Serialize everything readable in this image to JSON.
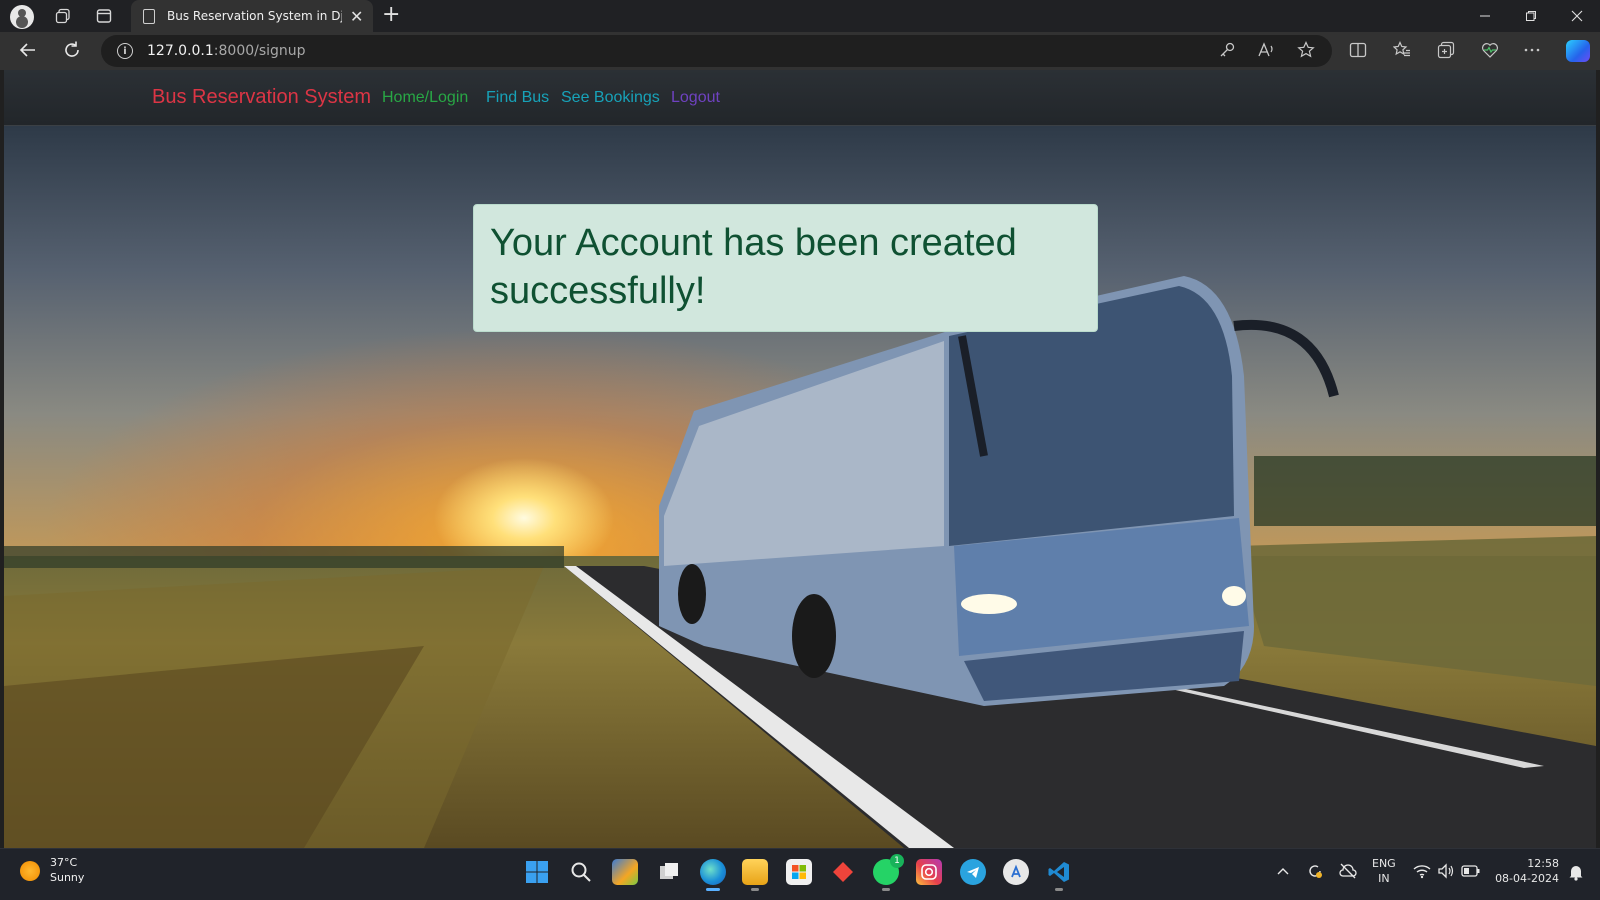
{
  "browser": {
    "tab_title": "Bus Reservation System in Djang",
    "url_host": "127.0.0.1",
    "url_path": ":8000/signup",
    "new_tab_symbol": "+",
    "close_tab_symbol": "✕"
  },
  "navbar": {
    "brand": "Bus Reservation System",
    "links": [
      {
        "label": "Home/Login",
        "color": "#28a745"
      },
      {
        "label": "Find Bus",
        "color": "#17a2b8"
      },
      {
        "label": "See Bookings",
        "color": "#17a2b8"
      },
      {
        "label": "Logout",
        "color": "#6f42c1"
      }
    ],
    "brand_color": "#dc3545"
  },
  "alert": {
    "message": "Your Account has been created successfully!",
    "bg_color": "#d1e7dd",
    "text_color": "#0f5132"
  },
  "taskbar": {
    "weather_temp": "37°C",
    "weather_desc": "Sunny",
    "lang_line1": "ENG",
    "lang_line2": "IN",
    "time": "12:58",
    "date": "08-04-2024",
    "whatsapp_badge": "1"
  }
}
